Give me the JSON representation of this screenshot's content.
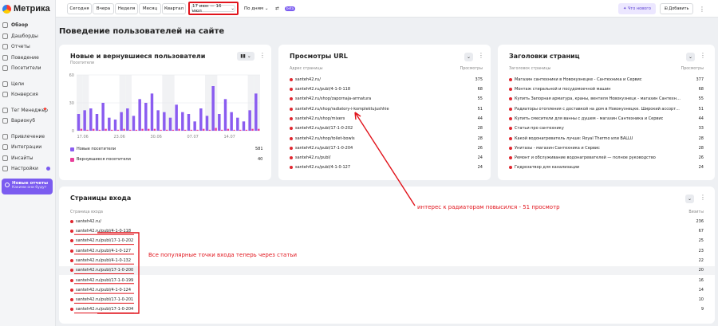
{
  "app": {
    "logo_text": "Метрика"
  },
  "sidebar": {
    "items": [
      {
        "label": "Обзор",
        "icon": "grid-icon",
        "active": true
      },
      {
        "label": "Дашборды",
        "icon": "dashboard-icon"
      },
      {
        "label": "Отчеты",
        "icon": "reports-icon"
      },
      {
        "label": "Поведение",
        "icon": "behavior-icon"
      },
      {
        "label": "Посетители",
        "icon": "visitors-icon"
      },
      {
        "label": "Цели",
        "icon": "target-icon"
      },
      {
        "label": "Конверсия",
        "icon": "conversion-icon"
      },
      {
        "label": "Тег Менеджер",
        "icon": "tag-icon"
      },
      {
        "label": "Вариокуб",
        "icon": "cube-icon"
      },
      {
        "label": "Привлечение",
        "icon": "acquisition-icon"
      },
      {
        "label": "Интеграции",
        "icon": "integrations-icon"
      },
      {
        "label": "Инсайты",
        "icon": "insights-icon"
      },
      {
        "label": "Настройки",
        "icon": "settings-icon"
      }
    ],
    "new_reports": {
      "title": "Новые отчеты",
      "subtitle": "Какими они будут"
    }
  },
  "topbar": {
    "periods": [
      "Сегодня",
      "Вчера",
      "Неделя",
      "Месяц",
      "Квартал"
    ],
    "date_range": "17 июн — 16 июл",
    "group_by": "По дням",
    "beta_badge": "beta",
    "whats_new": "Что нового",
    "add": "Добавить"
  },
  "section_title": "Поведение пользователей на сайте",
  "users_card": {
    "title": "Новые и вернувшиеся пользователи",
    "subtitle": "Посетители",
    "legend": [
      {
        "label": "Новые посетители",
        "value": "581",
        "color": "#8a5cf0"
      },
      {
        "label": "Вернувшиеся посетители",
        "value": "40",
        "color": "#e83e9a"
      }
    ]
  },
  "chart_data": {
    "type": "bar",
    "ylabel": "Посетители",
    "ylim": [
      0,
      60
    ],
    "yticks": [
      "0",
      "30",
      "60"
    ],
    "xticks": [
      "17.06",
      "23.06",
      "30.06",
      "07.07",
      "14.07"
    ],
    "series": [
      {
        "name": "Новые посетители",
        "color": "#8a5cf0",
        "values": [
          18,
          22,
          24,
          18,
          30,
          14,
          12,
          20,
          24,
          16,
          34,
          30,
          40,
          22,
          20,
          14,
          28,
          20,
          18,
          10,
          24,
          16,
          48,
          18,
          34,
          20,
          14,
          10,
          22,
          40
        ]
      },
      {
        "name": "Вернувшиеся посетители",
        "color": "#e83e9a",
        "values": [
          2,
          1,
          2,
          1,
          2,
          1,
          1,
          2,
          1,
          1,
          2,
          2,
          2,
          1,
          1,
          1,
          2,
          1,
          1,
          1,
          2,
          1,
          3,
          1,
          2,
          1,
          1,
          1,
          2,
          2
        ]
      }
    ],
    "grid": true
  },
  "url_card": {
    "title": "Просмотры URL",
    "col_left": "Адрес страницы",
    "col_right": "Просмотры",
    "rows": [
      {
        "label": "santeh42.ru/",
        "value": "375"
      },
      {
        "label": "santeh42.ru/publ/4-1-0-118",
        "value": "68"
      },
      {
        "label": "santeh42.ru/shop/zapornaja-armatura",
        "value": "55"
      },
      {
        "label": "santeh42.ru/shop/radiatory-i-komplektujushhie",
        "value": "51"
      },
      {
        "label": "santeh42.ru/shop/mixers",
        "value": "44"
      },
      {
        "label": "santeh42.ru/publ/17-1-0-202",
        "value": "28"
      },
      {
        "label": "santeh42.ru/shop/toilet-bowls",
        "value": "28"
      },
      {
        "label": "santeh42.ru/publ/17-1-0-204",
        "value": "26"
      },
      {
        "label": "santeh42.ru/publ/",
        "value": "24"
      },
      {
        "label": "santeh42.ru/publ/4-1-0-127",
        "value": "24"
      }
    ]
  },
  "headers_card": {
    "title": "Заголовки страниц",
    "col_left": "Заголовок страницы",
    "col_right": "Просмотры",
    "rows": [
      {
        "label": "Магазин сантехники в Новокузнецке - Сантехника и Сервис",
        "value": "377"
      },
      {
        "label": "Монтаж стиральной и посудомоечной машин",
        "value": "68"
      },
      {
        "label": "Купить Запорная арматура, краны, вентиля Новокузнецк - магазин Сантехник...",
        "value": "55"
      },
      {
        "label": "Радиаторы отопления с доставкой на дом в Новокузнецке. Широкий ассорт...",
        "value": "51"
      },
      {
        "label": "Купить смесители для ванны с душем - магазин Сантехника и Сервис",
        "value": "44"
      },
      {
        "label": "Статьи про сантехнику",
        "value": "33"
      },
      {
        "label": "Какой водонагреватель лучше: Royal Thermo или BALLU",
        "value": "28"
      },
      {
        "label": "Унитазы - магазин Сантехника и Сервис",
        "value": "28"
      },
      {
        "label": "Ремонт и обслуживание водонагревателей — полное руководство",
        "value": "26"
      },
      {
        "label": "Гидрозатвор для канализации",
        "value": "24"
      }
    ]
  },
  "entry_card": {
    "title": "Страницы входа",
    "col_left": "Страница входа",
    "col_right": "Визиты",
    "rows": [
      {
        "label": "santeh42.ru/",
        "value": "236"
      },
      {
        "label": "santeh42.ru/publ/4-1-0-118",
        "value": "67"
      },
      {
        "label": "santeh42.ru/publ/17-1-0-202",
        "value": "25"
      },
      {
        "label": "santeh42.ru/publ/4-1-0-127",
        "value": "23"
      },
      {
        "label": "santeh42.ru/publ/4-1-0-132",
        "value": "22"
      },
      {
        "label": "santeh42.ru/publ/17-1-0-200",
        "value": "20"
      },
      {
        "label": "santeh42.ru/publ/17-1-0-199",
        "value": "16"
      },
      {
        "label": "santeh42.ru/publ/4-1-0-124",
        "value": "14"
      },
      {
        "label": "santeh42.ru/publ/17-1-0-201",
        "value": "10"
      },
      {
        "label": "santeh42.ru/publ/17-1-0-204",
        "value": "9"
      }
    ]
  },
  "annotations": {
    "radiators": "интерес к радиаторам повысился - 51 просмотр",
    "articles": "Все популярные точки входа теперь через статьи",
    "color": "#e1141c"
  }
}
